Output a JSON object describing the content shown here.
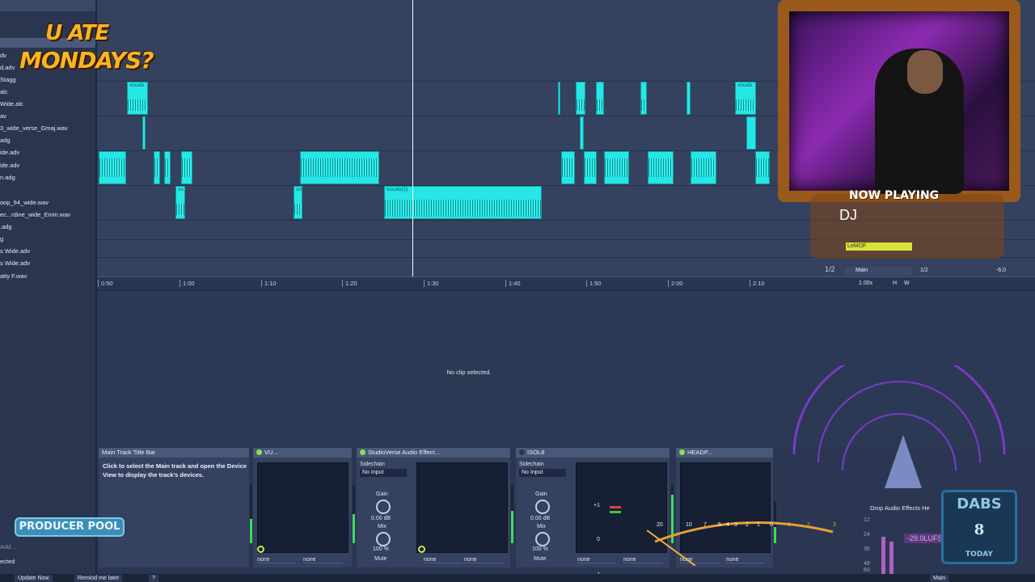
{
  "browser": {
    "files": [
      "dv",
      "d.adv",
      "Stagg",
      "alc",
      "Wide.alc",
      "av",
      "3_wide_verse_Gmaj.wav",
      "adg",
      "ide.adv",
      "ide.adv",
      "n.adg",
      "oop_94_wide.wav",
      "ec...rdine_wide_Emin.wav",
      ".adg",
      "g",
      "s Wide.adv",
      "s Wide.adv",
      "atty F.wav"
    ],
    "search_placeholder": "Add...",
    "bottom_text": "ected"
  },
  "logo": {
    "line1": "U ATE",
    "line2": "MONDAYS?"
  },
  "arrangement": {
    "clips": [
      {
        "label": "vocals"
      },
      {
        "label": "vocals"
      },
      {
        "label": "vo"
      },
      {
        "label": "vo"
      },
      {
        "label": "vocals(1)"
      },
      {
        "label": "vocals"
      }
    ],
    "ruler": [
      "0:50",
      "1:00",
      "1:10",
      "1:20",
      "1:30",
      "1:40",
      "1:50",
      "2:00",
      "2:10"
    ],
    "page_indicator": "1/2"
  },
  "clip_view": {
    "empty_text": "No clip selected."
  },
  "info_view": {
    "title": "Main Track Title Bar",
    "description": "Click to select the Main track and open the Device View to display the track's devices."
  },
  "devices": [
    {
      "name": "VU...",
      "routing": [
        "none",
        "none"
      ]
    },
    {
      "name": "StudioVerse Audio Effect...",
      "sidechain": "Sidechain",
      "input": "No Input",
      "gain_label": "Gain",
      "gain": "0.00 dB",
      "mix_label": "Mix",
      "mix": "100 %",
      "button": "Mute",
      "routing": [
        "none",
        "none"
      ]
    },
    {
      "name": "ISOL8",
      "sidechain": "Sidechain",
      "input": "No Input",
      "gain_label": "Gain",
      "gain": "0.00 dB",
      "mix_label": "Mix",
      "mix": "100 %",
      "button": "Mute",
      "routing": [
        "none",
        "none"
      ],
      "scale": [
        "+1",
        "0",
        "-1"
      ]
    },
    {
      "name": "HEADP...",
      "routing": [
        "none",
        "none"
      ],
      "scale": [
        "20",
        "10",
        "7",
        "5",
        "4",
        "3",
        "2",
        "1",
        "0",
        "1",
        "2",
        "3"
      ]
    }
  ],
  "stream": {
    "now_playing": "NOW PLAYING",
    "dj": "DJ",
    "mini_track": "LeMOF",
    "mini_track2": "Main",
    "mini_val": "1/2",
    "tempo": "1.00x",
    "hw": [
      "H",
      "W"
    ],
    "db": "-6.0"
  },
  "overlays": {
    "drop_hint": "Drop Audio Effects He",
    "lufs": "-29.0LUFS",
    "lufs_scale": [
      "12",
      "24",
      "36",
      "48",
      "60"
    ],
    "dabs_title": "DABS",
    "dabs_count": "8",
    "dabs_sub": "TODAY",
    "producer_pool": "PRODUCER POOL"
  },
  "status": {
    "update_now": "Update Now",
    "remind_later": "Remind me later",
    "help": "?",
    "main": "Main"
  },
  "colors": {
    "clip": "#26e6e6",
    "background": "#2c3955",
    "meter": "#3fdc5a",
    "power": "#8fe04a"
  }
}
